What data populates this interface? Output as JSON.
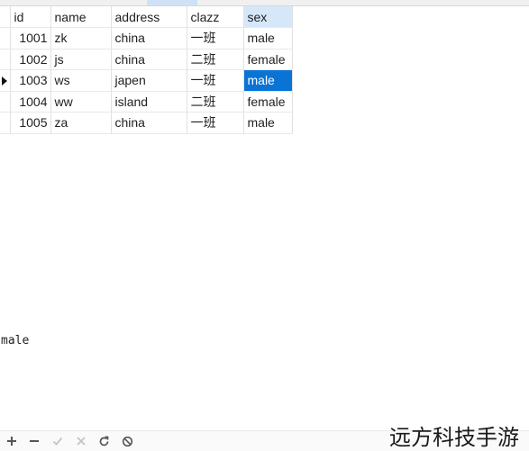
{
  "grid": {
    "columns": [
      "id",
      "name",
      "address",
      "clazz",
      "sex"
    ],
    "rows": [
      {
        "id": "1001",
        "name": "zk",
        "address": "china",
        "clazz": "一班",
        "sex": "male"
      },
      {
        "id": "1002",
        "name": "js",
        "address": "china",
        "clazz": "二班",
        "sex": "female"
      },
      {
        "id": "1003",
        "name": "ws",
        "address": "japen",
        "clazz": "一班",
        "sex": "male"
      },
      {
        "id": "1004",
        "name": "ww",
        "address": "island",
        "clazz": "二班",
        "sex": "female"
      },
      {
        "id": "1005",
        "name": "za",
        "address": "china",
        "clazz": "一班",
        "sex": "male"
      }
    ],
    "current_row_index": 2,
    "selected_column": "sex"
  },
  "preview": {
    "value": "male"
  },
  "toolbar": {
    "icons": [
      "add-icon",
      "delete-icon",
      "apply-icon",
      "discard-icon",
      "refresh-icon",
      "stop-icon"
    ]
  },
  "watermark": {
    "text": "远方科技手游"
  },
  "colors": {
    "selection": "#0a74d6",
    "sorted_header": "#d6e7fa"
  }
}
